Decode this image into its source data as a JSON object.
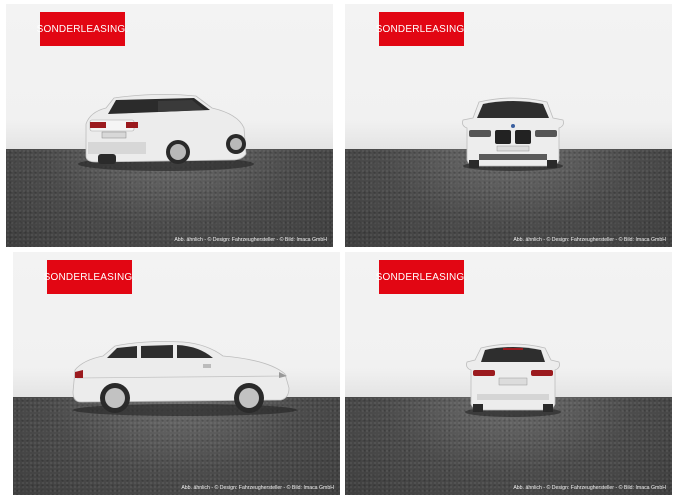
{
  "gallery": {
    "tiles": [
      {
        "view": "rear-three-quarter",
        "badge": "SONDERLEASING.",
        "credit": "Abb. ähnlich - © Design: Fahrzeughersteller - © Bild: Imaca GmbH"
      },
      {
        "view": "front",
        "badge": "SONDERLEASING.",
        "credit": "Abb. ähnlich - © Design: Fahrzeughersteller - © Bild: Imaca GmbH"
      },
      {
        "view": "side",
        "badge": "SONDERLEASING.",
        "credit": "Abb. ähnlich - © Design: Fahrzeughersteller - © Bild: Imaca GmbH"
      },
      {
        "view": "rear",
        "badge": "SONDERLEASING.",
        "credit": "Abb. ähnlich - © Design: Fahrzeughersteller - © Bild: Imaca GmbH"
      }
    ]
  },
  "colors": {
    "badge_red": "#e20613",
    "car_body": "#e9e9e9",
    "floor": "#4c4c4c",
    "wall": "#f1f1f1"
  }
}
